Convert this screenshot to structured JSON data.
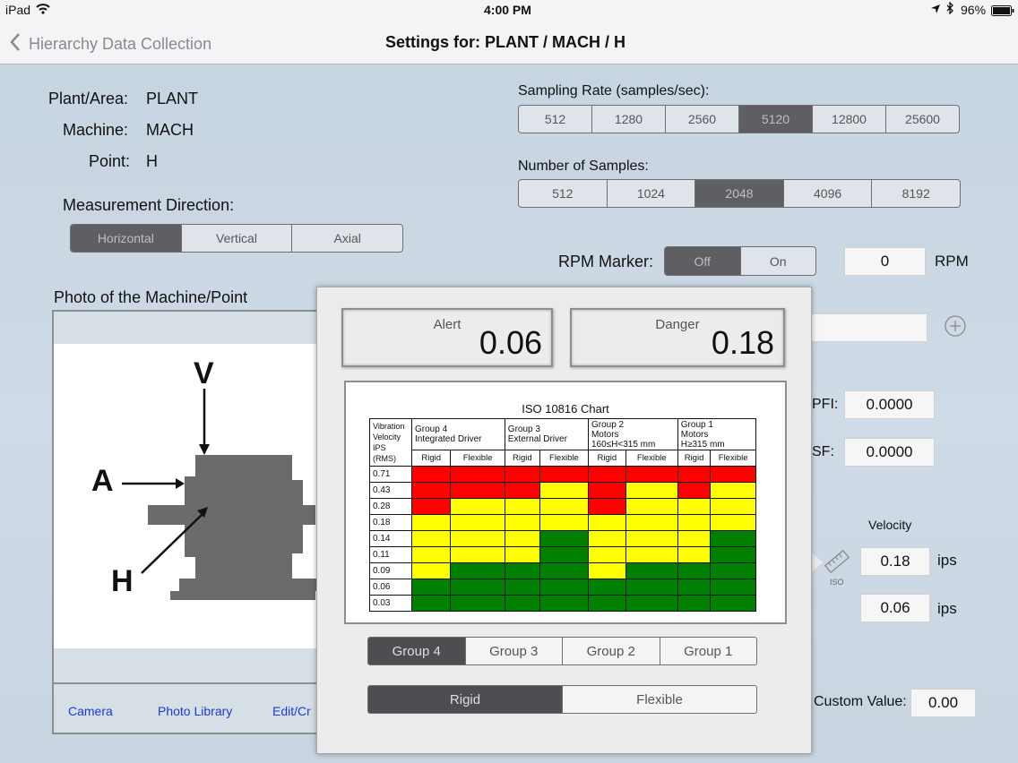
{
  "status": {
    "device": "iPad",
    "time": "4:00 PM",
    "battery": "96%"
  },
  "nav": {
    "back_label": "Hierarchy Data Collection",
    "title": "Settings for: PLANT / MACH / H"
  },
  "info": {
    "plant_label": "Plant/Area:",
    "plant_value": "PLANT",
    "machine_label": "Machine:",
    "machine_value": "MACH",
    "point_label": "Point:",
    "point_value": "H"
  },
  "direction": {
    "label": "Measurement Direction:",
    "options": [
      "Horizontal",
      "Vertical",
      "Axial"
    ],
    "selected": "Horizontal"
  },
  "sampling": {
    "label": "Sampling Rate (samples/sec):",
    "options": [
      "512",
      "1280",
      "2560",
      "5120",
      "12800",
      "25600"
    ],
    "selected": "5120"
  },
  "samples": {
    "label": "Number of Samples:",
    "options": [
      "512",
      "1024",
      "2048",
      "4096",
      "8192"
    ],
    "selected": "2048"
  },
  "rpm": {
    "label": "RPM Marker:",
    "options": [
      "Off",
      "On"
    ],
    "selected": "Off",
    "value": "0",
    "unit": "RPM"
  },
  "photo": {
    "title": "Photo of the Machine/Point",
    "labels": {
      "v": "V",
      "a": "A",
      "h": "H"
    },
    "buttons": {
      "camera": "Camera",
      "library": "Photo Library",
      "edit": "Edit/Cr"
    }
  },
  "right": {
    "pfi_label": "PFI:",
    "pfi_value": "0.0000",
    "sf_label": "SF:",
    "sf_value": "0.0000",
    "velocity_label": "Velocity",
    "iso_label": "ISO",
    "alert_value": "0.18",
    "alert_unit": "ips",
    "danger_value": "0.06",
    "danger_unit": "ips",
    "custom_label": "Custom Value:",
    "custom_value": "0.00"
  },
  "popup": {
    "alert_label": "Alert",
    "alert_value": "0.06",
    "danger_label": "Danger",
    "danger_value": "0.18",
    "chart_title": "ISO 10816 Chart",
    "row_header": [
      "Vibration",
      "Velocity",
      "IPS",
      "(RMS)"
    ],
    "groups": [
      {
        "line1": "Group 4",
        "line2": "Integrated Driver",
        "line3": ""
      },
      {
        "line1": "Group 3",
        "line2": "External Driver",
        "line3": ""
      },
      {
        "line1": "Group 2",
        "line2": "Motors",
        "line3": "160≤H<315 mm"
      },
      {
        "line1": "Group 1",
        "line2": "Motors",
        "line3": "H≥315 mm"
      }
    ],
    "sub_headers": [
      "Rigid",
      "Flexible",
      "Rigid",
      "Flexible",
      "Rigid",
      "Flexible",
      "Rigid",
      "Flexible"
    ],
    "rows": [
      {
        "v": "0.71",
        "c": [
          "R",
          "R",
          "R",
          "R",
          "R",
          "R",
          "R",
          "R"
        ]
      },
      {
        "v": "0.43",
        "c": [
          "R",
          "R",
          "R",
          "Y",
          "R",
          "Y",
          "R",
          "Y"
        ]
      },
      {
        "v": "0.28",
        "c": [
          "R",
          "Y",
          "Y",
          "Y",
          "R",
          "Y",
          "Y",
          "Y"
        ]
      },
      {
        "v": "0.18",
        "c": [
          "Y",
          "Y",
          "Y",
          "Y",
          "Y",
          "Y",
          "Y",
          "Y"
        ]
      },
      {
        "v": "0.14",
        "c": [
          "Y",
          "Y",
          "Y",
          "G",
          "Y",
          "Y",
          "Y",
          "G"
        ]
      },
      {
        "v": "0.11",
        "c": [
          "Y",
          "Y",
          "Y",
          "G",
          "Y",
          "Y",
          "Y",
          "G"
        ]
      },
      {
        "v": "0.09",
        "c": [
          "Y",
          "G",
          "G",
          "G",
          "Y",
          "G",
          "G",
          "G"
        ]
      },
      {
        "v": "0.06",
        "c": [
          "G",
          "G",
          "G",
          "G",
          "G",
          "G",
          "G",
          "G"
        ]
      },
      {
        "v": "0.03",
        "c": [
          "G",
          "G",
          "G",
          "G",
          "G",
          "G",
          "G",
          "G"
        ]
      }
    ],
    "colors": {
      "R": "#ff0000",
      "Y": "#ffff00",
      "G": "#008000"
    },
    "group_options": [
      "Group 4",
      "Group 3",
      "Group 2",
      "Group 1"
    ],
    "group_selected": "Group 4",
    "mount_options": [
      "Rigid",
      "Flexible"
    ],
    "mount_selected": "Rigid"
  }
}
